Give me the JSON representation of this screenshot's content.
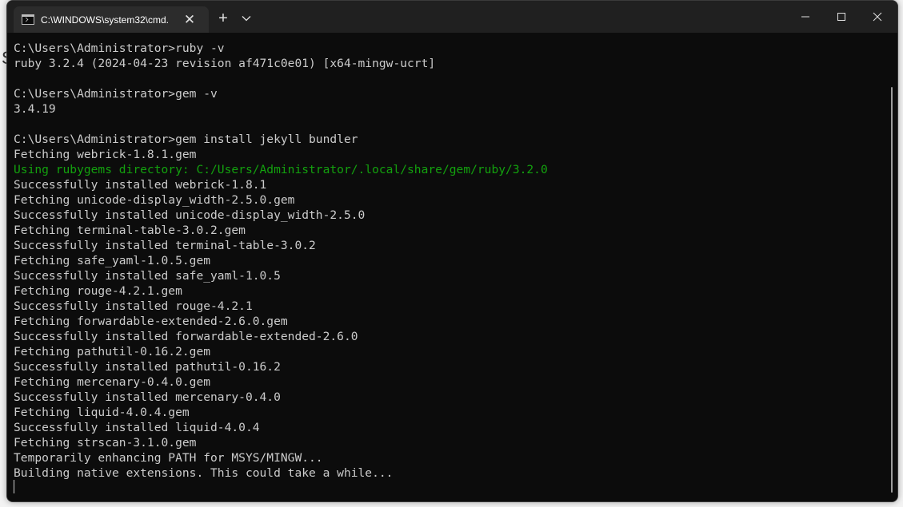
{
  "window": {
    "tab_title": "C:\\WINDOWS\\system32\\cmd.",
    "tab_close": "✕",
    "new_tab": "+",
    "icons": [
      "cmd-icon",
      "close-icon",
      "plus-icon",
      "chevron-down-icon",
      "minimize-icon",
      "maximize-icon",
      "close-window-icon"
    ]
  },
  "background": {
    "letter": "S"
  },
  "console": {
    "lines": [
      {
        "text": "C:\\Users\\Administrator>ruby -v",
        "color": "#cccccc"
      },
      {
        "text": "ruby 3.2.4 (2024-04-23 revision af471c0e01) [x64-mingw-ucrt]",
        "color": "#cccccc"
      },
      {
        "text": "",
        "color": "#cccccc"
      },
      {
        "text": "C:\\Users\\Administrator>gem -v",
        "color": "#cccccc"
      },
      {
        "text": "3.4.19",
        "color": "#cccccc"
      },
      {
        "text": "",
        "color": "#cccccc"
      },
      {
        "text": "C:\\Users\\Administrator>gem install jekyll bundler",
        "color": "#cccccc"
      },
      {
        "text": "Fetching webrick-1.8.1.gem",
        "color": "#cccccc"
      },
      {
        "text": "Using rubygems directory: C:/Users/Administrator/.local/share/gem/ruby/3.2.0",
        "color": "#13a10e"
      },
      {
        "text": "Successfully installed webrick-1.8.1",
        "color": "#cccccc"
      },
      {
        "text": "Fetching unicode-display_width-2.5.0.gem",
        "color": "#cccccc"
      },
      {
        "text": "Successfully installed unicode-display_width-2.5.0",
        "color": "#cccccc"
      },
      {
        "text": "Fetching terminal-table-3.0.2.gem",
        "color": "#cccccc"
      },
      {
        "text": "Successfully installed terminal-table-3.0.2",
        "color": "#cccccc"
      },
      {
        "text": "Fetching safe_yaml-1.0.5.gem",
        "color": "#cccccc"
      },
      {
        "text": "Successfully installed safe_yaml-1.0.5",
        "color": "#cccccc"
      },
      {
        "text": "Fetching rouge-4.2.1.gem",
        "color": "#cccccc"
      },
      {
        "text": "Successfully installed rouge-4.2.1",
        "color": "#cccccc"
      },
      {
        "text": "Fetching forwardable-extended-2.6.0.gem",
        "color": "#cccccc"
      },
      {
        "text": "Successfully installed forwardable-extended-2.6.0",
        "color": "#cccccc"
      },
      {
        "text": "Fetching pathutil-0.16.2.gem",
        "color": "#cccccc"
      },
      {
        "text": "Successfully installed pathutil-0.16.2",
        "color": "#cccccc"
      },
      {
        "text": "Fetching mercenary-0.4.0.gem",
        "color": "#cccccc"
      },
      {
        "text": "Successfully installed mercenary-0.4.0",
        "color": "#cccccc"
      },
      {
        "text": "Fetching liquid-4.0.4.gem",
        "color": "#cccccc"
      },
      {
        "text": "Successfully installed liquid-4.0.4",
        "color": "#cccccc"
      },
      {
        "text": "Fetching strscan-3.1.0.gem",
        "color": "#cccccc"
      },
      {
        "text": "Temporarily enhancing PATH for MSYS/MINGW...",
        "color": "#cccccc"
      },
      {
        "text": "Building native extensions. This could take a while...",
        "color": "#cccccc"
      }
    ]
  },
  "colors": {
    "console_bg": "#0c0c0c",
    "titlebar_bg": "#202020",
    "text": "#cccccc",
    "green": "#13a10e"
  }
}
